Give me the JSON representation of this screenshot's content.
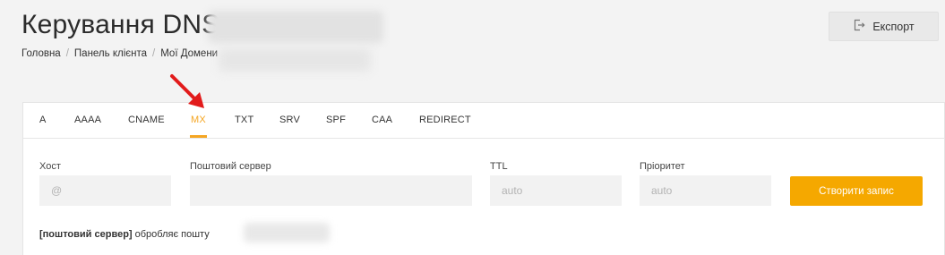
{
  "header": {
    "title": "Керування DNS",
    "breadcrumb": [
      "Головна",
      "Панель клієнта",
      "Мої Домени"
    ],
    "export_label": "Експорт"
  },
  "tabs": [
    {
      "label": "A",
      "active": false
    },
    {
      "label": "AAAA",
      "active": false
    },
    {
      "label": "CNAME",
      "active": false
    },
    {
      "label": "MX",
      "active": true
    },
    {
      "label": "TXT",
      "active": false
    },
    {
      "label": "SRV",
      "active": false
    },
    {
      "label": "SPF",
      "active": false
    },
    {
      "label": "CAA",
      "active": false
    },
    {
      "label": "REDIRECT",
      "active": false
    }
  ],
  "form": {
    "host": {
      "label": "Хост",
      "placeholder": "@"
    },
    "mail_server": {
      "label": "Поштовий сервер",
      "placeholder": ""
    },
    "ttl": {
      "label": "TTL",
      "placeholder": "auto"
    },
    "priority": {
      "label": "Пріоритет",
      "placeholder": "auto"
    },
    "create_label": "Створити запис"
  },
  "hint": {
    "bold": "[поштовий сервер]",
    "text": "обробляє пошту"
  },
  "colors": {
    "accent": "#f5a623",
    "button": "#f5a800",
    "annotation_arrow": "#e21b1b"
  },
  "icons": {
    "export": "export-icon",
    "annotation": "red-arrow-icon"
  }
}
